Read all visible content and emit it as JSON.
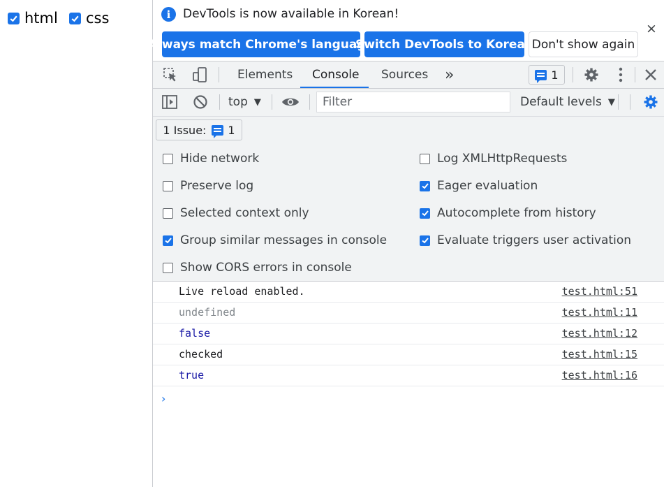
{
  "page": {
    "checkboxes": [
      {
        "label": "html",
        "checked": true
      },
      {
        "label": "css",
        "checked": true
      }
    ]
  },
  "infobar": {
    "message": "DevTools is now available in Korean!",
    "buttons": {
      "match_language": "Always match Chrome's language",
      "switch_korean": "Switch DevTools to Korean",
      "dont_show": "Don't show again"
    },
    "close_glyph": "×"
  },
  "tabs": {
    "items": [
      "Elements",
      "Console",
      "Sources"
    ],
    "active": "Console",
    "more_glyph": "»",
    "issues_count": "1"
  },
  "toolbar": {
    "context": "top",
    "filter_placeholder": "Filter",
    "levels": "Default levels"
  },
  "issues": {
    "label": "1 Issue:",
    "count": "1"
  },
  "settings": {
    "left": [
      {
        "label": "Hide network",
        "checked": false
      },
      {
        "label": "Preserve log",
        "checked": false
      },
      {
        "label": "Selected context only",
        "checked": false
      },
      {
        "label": "Group similar messages in console",
        "checked": true
      },
      {
        "label": "Show CORS errors in console",
        "checked": false
      }
    ],
    "right": [
      {
        "label": "Log XMLHttpRequests",
        "checked": false
      },
      {
        "label": "Eager evaluation",
        "checked": true
      },
      {
        "label": "Autocomplete from history",
        "checked": true
      },
      {
        "label": "Evaluate triggers user activation",
        "checked": true
      }
    ]
  },
  "console": {
    "messages": [
      {
        "text": "Live reload enabled.",
        "source": "test.html:51",
        "color": "#202124"
      },
      {
        "text": "undefined",
        "source": "test.html:11",
        "color": "#80868b"
      },
      {
        "text": "false",
        "source": "test.html:12",
        "color": "#1a1aa6"
      },
      {
        "text": "checked",
        "source": "test.html:15",
        "color": "#202124"
      },
      {
        "text": "true",
        "source": "test.html:16",
        "color": "#1a1aa6"
      }
    ],
    "prompt_glyph": "›"
  },
  "colors": {
    "accent": "#1a73e8",
    "panel_bg": "#f1f3f4"
  }
}
